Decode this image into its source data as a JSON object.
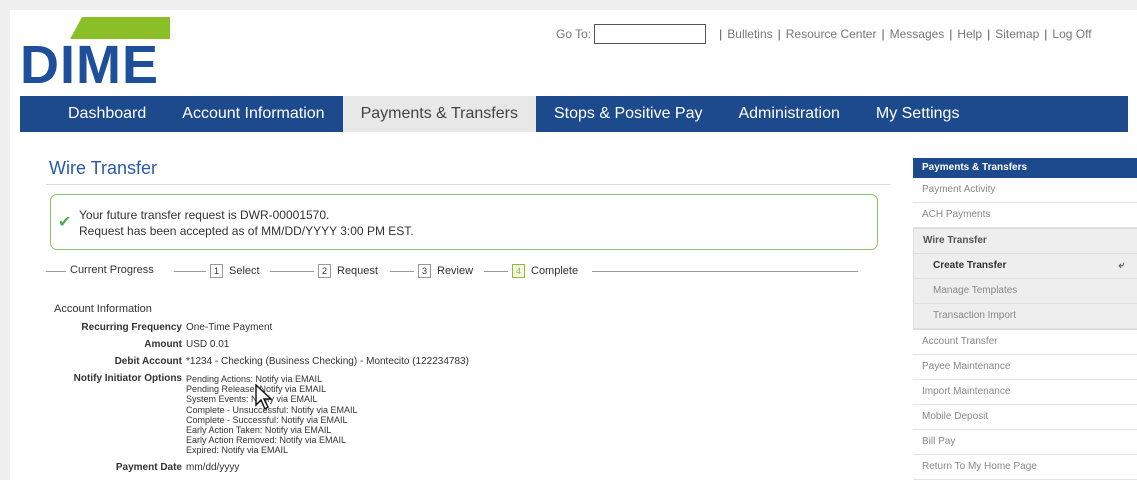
{
  "logo": {
    "text": "DIME"
  },
  "toplinks": {
    "goto_label": "Go To:",
    "goto_value": "",
    "links": [
      "Bulletins",
      "Resource Center",
      "Messages",
      "Help",
      "Sitemap",
      "Log Off"
    ]
  },
  "nav": {
    "tabs": [
      "Dashboard",
      "Account Information",
      "Payments & Transfers",
      "Stops & Positive Pay",
      "Administration",
      "My Settings"
    ],
    "active": "Payments & Transfers"
  },
  "page": {
    "title": "Wire Transfer"
  },
  "notice": {
    "line1": "Your future transfer request is DWR-00001570.",
    "line2": "Request has been accepted as of MM/DD/YYYY 3:00 PM EST."
  },
  "progress": {
    "label": "Current Progress",
    "steps": [
      {
        "num": "1",
        "label": "Select"
      },
      {
        "num": "2",
        "label": "Request"
      },
      {
        "num": "3",
        "label": "Review"
      },
      {
        "num": "4",
        "label": "Complete"
      }
    ]
  },
  "details": {
    "section": "Account Information",
    "recurring_label": "Recurring Frequency",
    "recurring_value": "One-Time Payment",
    "amount_label": "Amount",
    "amount_value": "USD 0.01",
    "debit_label": "Debit Account",
    "debit_value": "*1234 - Checking (Business Checking) - Montecito (122234783)",
    "notify_label": "Notify Initiator Options",
    "notify_items": [
      "Pending Actions: Notify via EMAIL",
      "Pending Release: Notify via EMAIL",
      "System Events: Notify via EMAIL",
      "Complete - Unsuccessful: Notify via EMAIL",
      "Complete - Successful: Notify via EMAIL",
      "Early Action Taken: Notify via EMAIL",
      "Early Action Removed: Notify via EMAIL",
      "Expired: Notify via EMAIL"
    ],
    "payment_date_label": "Payment Date",
    "payment_date_value": "mm/dd/yyyy"
  },
  "sidebar": {
    "header": "Payments & Transfers",
    "items_top": [
      "Payment Activity",
      "ACH Payments"
    ],
    "group": {
      "title": "Wire Transfer",
      "items": [
        "Create Transfer",
        "Manage Templates",
        "Transaction Import"
      ],
      "current": "Create Transfer"
    },
    "items_bottom": [
      "Account Transfer",
      "Payee Maintenance",
      "Import Maintenance",
      "Mobile Deposit",
      "Bill Pay",
      "Return To My Home Page"
    ]
  },
  "colors": {
    "brand_blue": "#1c4a8c",
    "brand_green": "#8bbf27",
    "success_border": "#8cc46a"
  }
}
